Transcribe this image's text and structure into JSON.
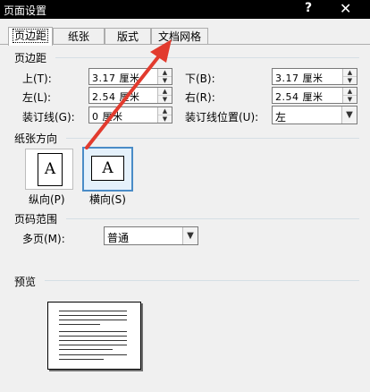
{
  "window": {
    "title": "页面设置",
    "help": "?",
    "close": "✕"
  },
  "tabs": [
    {
      "label": "页边距"
    },
    {
      "label": "纸张"
    },
    {
      "label": "版式"
    },
    {
      "label": "文档网格"
    }
  ],
  "margins": {
    "section_title": "页边距",
    "top": {
      "label": "上(T):",
      "value": "3.17 厘米"
    },
    "bottom": {
      "label": "下(B):",
      "value": "3.17 厘米"
    },
    "left": {
      "label": "左(L):",
      "value": "2.54 厘米"
    },
    "right": {
      "label": "右(R):",
      "value": "2.54 厘米"
    },
    "gutter": {
      "label": "装订线(G):",
      "value": "0 厘米"
    },
    "gutter_pos": {
      "label": "装订线位置(U):",
      "value": "左"
    }
  },
  "orientation": {
    "section_title": "纸张方向",
    "portrait": {
      "label": "纵向(P)",
      "glyph": "A"
    },
    "landscape": {
      "label": "横向(S)",
      "glyph": "A"
    }
  },
  "pages": {
    "section_title": "页码范围",
    "multi_label": "多页(M):",
    "multi_value": "普通"
  },
  "preview": {
    "section_title": "预览"
  },
  "annotation": {
    "color": "#e23b2e"
  }
}
